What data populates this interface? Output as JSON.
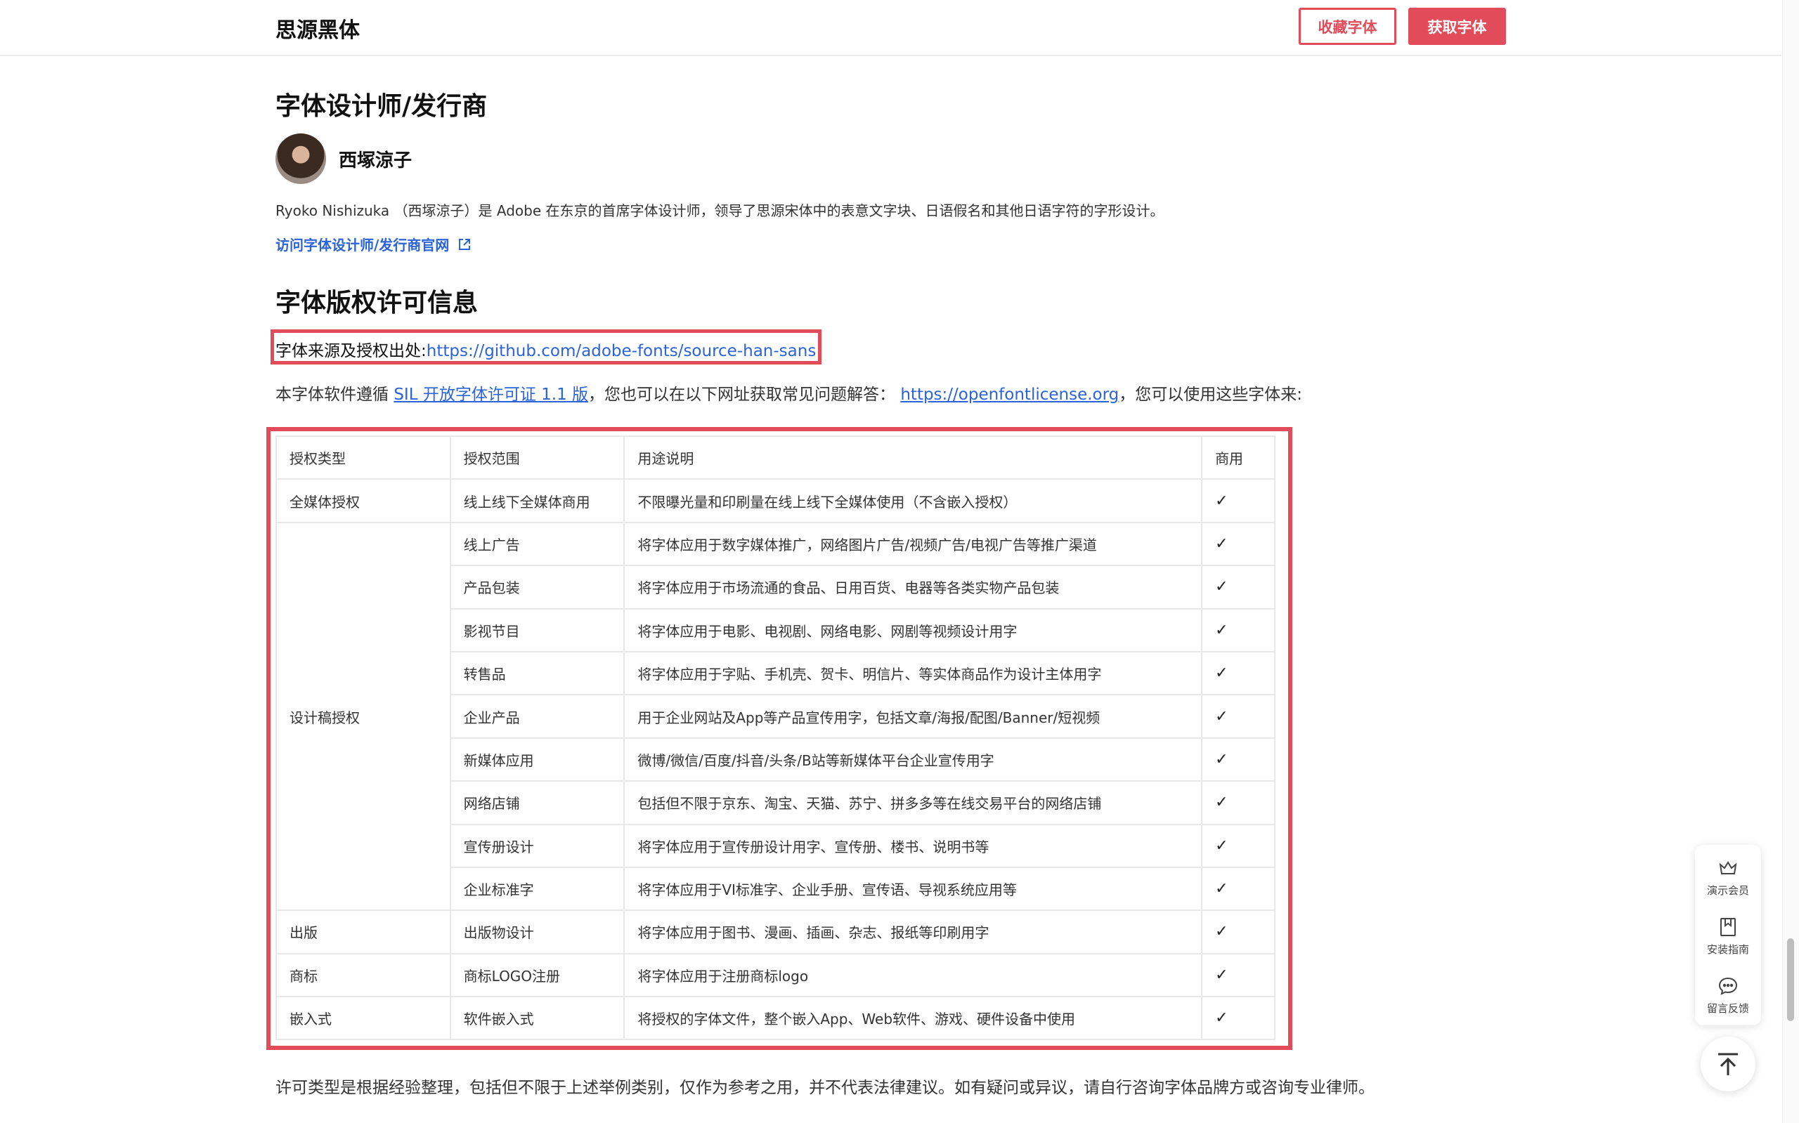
{
  "header": {
    "site_title": "思源黑体",
    "collect_label": "收藏字体",
    "get_label": "获取字体"
  },
  "designer_section": {
    "heading": "字体设计师/发行商",
    "name": "西塚涼子",
    "description": "Ryoko Nishizuka （西塚涼子）是 Adobe 在东京的首席字体设计师，领导了思源宋体中的表意文字块、日语假名和其他日语字符的字形设计。",
    "link_label": "访问字体设计师/发行商官网"
  },
  "license_section": {
    "heading": "字体版权许可信息",
    "source_prefix": "字体来源及授权出处:",
    "source_url": "https://github.com/adobe-fonts/source-han-sans",
    "license_text_1": "本字体软件遵循",
    "license_link": "SIL 开放字体许可证 1.1 版",
    "license_text_2": "，您也可以在以下网址获取常见问题解答：",
    "faq_link": "https://openfontlicense.org",
    "license_text_3": "，您可以使用这些字体来:"
  },
  "table": {
    "headers": [
      "授权类型",
      "授权范围",
      "用途说明",
      "商用"
    ],
    "check": "✓",
    "groups": {
      "media": "全媒体授权",
      "design": "设计稿授权",
      "publish": "出版",
      "trademark": "商标",
      "embed": "嵌入式"
    },
    "rows": [
      {
        "scope": "线上线下全媒体商用",
        "desc": "不限曝光量和印刷量在线上线下全媒体使用（不含嵌入授权）"
      },
      {
        "scope": "线上广告",
        "desc": "将字体应用于数字媒体推广，网络图片广告/视频广告/电视广告等推广渠道"
      },
      {
        "scope": "产品包装",
        "desc": "将字体应用于市场流通的食品、日用百货、电器等各类实物产品包装"
      },
      {
        "scope": "影视节目",
        "desc": "将字体应用于电影、电视剧、网络电影、网剧等视频设计用字"
      },
      {
        "scope": "转售品",
        "desc": "将字体应用于字贴、手机壳、贺卡、明信片、等实体商品作为设计主体用字"
      },
      {
        "scope": "企业产品",
        "desc": "用于企业网站及App等产品宣传用字，包括文章/海报/配图/Banner/短视频"
      },
      {
        "scope": "新媒体应用",
        "desc": "微博/微信/百度/抖音/头条/B站等新媒体平台企业宣传用字"
      },
      {
        "scope": "网络店铺",
        "desc": "包括但不限于京东、淘宝、天猫、苏宁、拼多多等在线交易平台的网络店铺"
      },
      {
        "scope": "宣传册设计",
        "desc": "将字体应用于宣传册设计用字、宣传册、楼书、说明书等"
      },
      {
        "scope": "企业标准字",
        "desc": "将字体应用于VI标准字、企业手册、宣传语、导视系统应用等"
      },
      {
        "scope": "出版物设计",
        "desc": "将字体应用于图书、漫画、插画、杂志、报纸等印刷用字"
      },
      {
        "scope": "商标LOGO注册",
        "desc": "将字体应用于注册商标logo"
      },
      {
        "scope": "软件嵌入式",
        "desc": "将授权的字体文件，整个嵌入App、Web软件、游戏、硬件设备中使用"
      }
    ]
  },
  "disclaimer": "许可类型是根据经验整理，包括但不限于上述举例类别，仅作为参考之用，并不代表法律建议。如有疑问或异议，请自行咨询字体品牌方或咨询专业律师。",
  "float_panel": {
    "vip": "演示会员",
    "guide": "安装指南",
    "feedback": "留言反馈"
  },
  "colors": {
    "accent": "#e14b5a",
    "link": "#2b63d9"
  },
  "icons": [
    "crown-icon",
    "bookmark-icon",
    "chat-icon",
    "external-link-icon",
    "arrow-up-icon"
  ]
}
